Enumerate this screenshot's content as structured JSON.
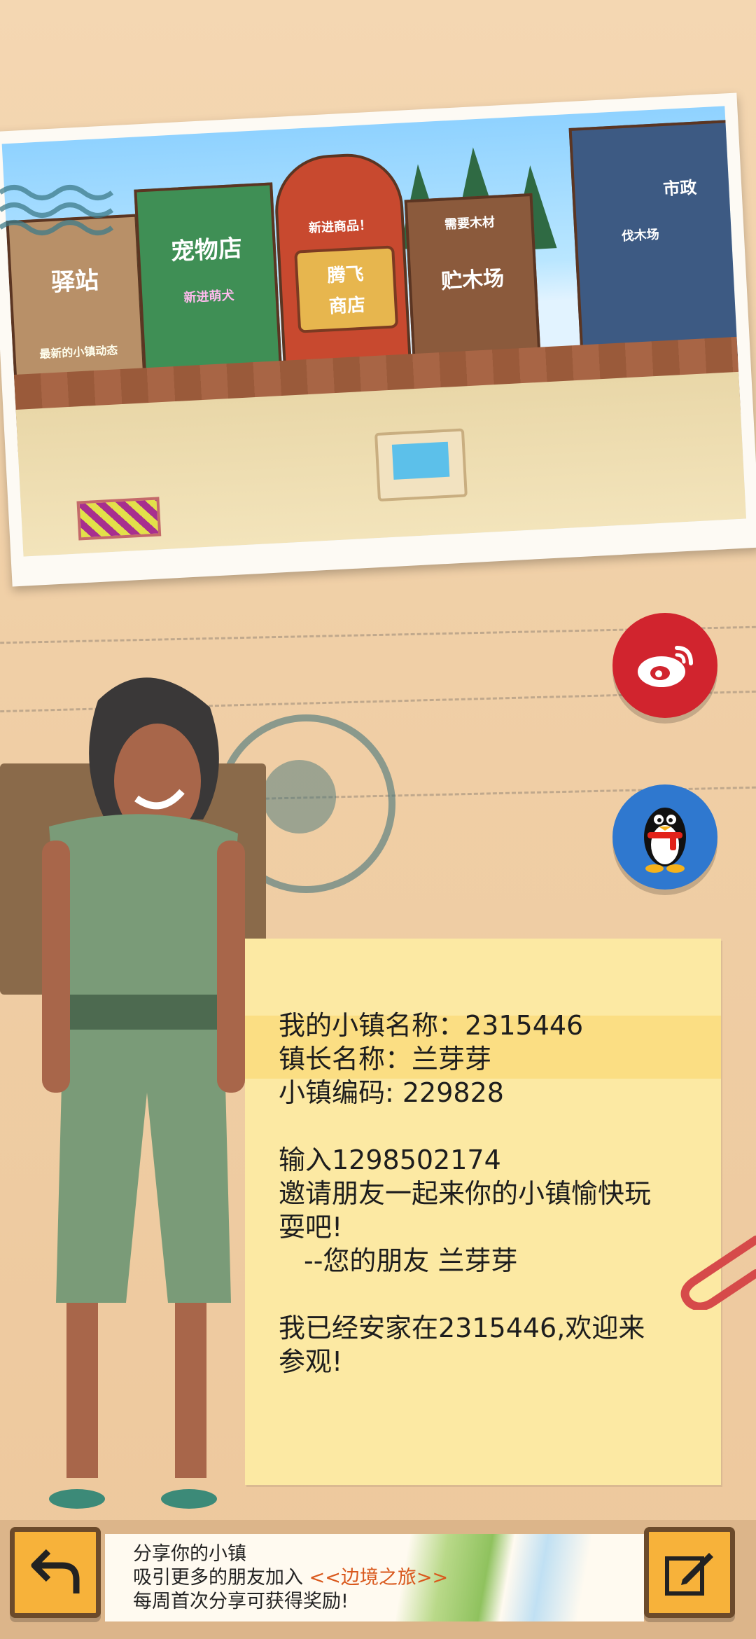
{
  "photo": {
    "signs": {
      "station": "驿站",
      "pet_shop": "宠物店",
      "shop_line1": "腾飞",
      "shop_line2": "商店",
      "lumber_yard": "贮木场",
      "new_goods": "新进商品！",
      "new_pet": "新进萌犬",
      "wood_needed": "需要木材",
      "logging": "伐木场",
      "town_hall": "市政",
      "mail": "最新的小镇动态"
    }
  },
  "share": {
    "weibo_icon": "weibo-icon",
    "qq_icon": "qq-penguin-icon"
  },
  "note": {
    "town_name": "我的小镇名称：2315446",
    "mayor_name": "镇长名称：兰芽芽",
    "town_code": "小镇编码: 229828",
    "input_line": "输入1298502174",
    "invite_line1": "邀请朋友一起来你的小镇愉快玩",
    "invite_line2": "耍吧!",
    "signature": "--您的朋友 兰芽芽",
    "settled_line1": "我已经安家在2315446,欢迎来",
    "settled_line2": "参观!"
  },
  "bottom": {
    "line1": "分享你的小镇",
    "line2_prefix": "吸引更多的朋友加入 ",
    "line2_highlight": "<<边境之旅>>",
    "line3": "每周首次分享可获得奖励!"
  },
  "colors": {
    "background": "#f2d3ac",
    "note": "#fce9a3",
    "weibo": "#d1242e",
    "qq": "#2f78cf",
    "button": "#f7b23a",
    "highlight": "#d9581c"
  }
}
